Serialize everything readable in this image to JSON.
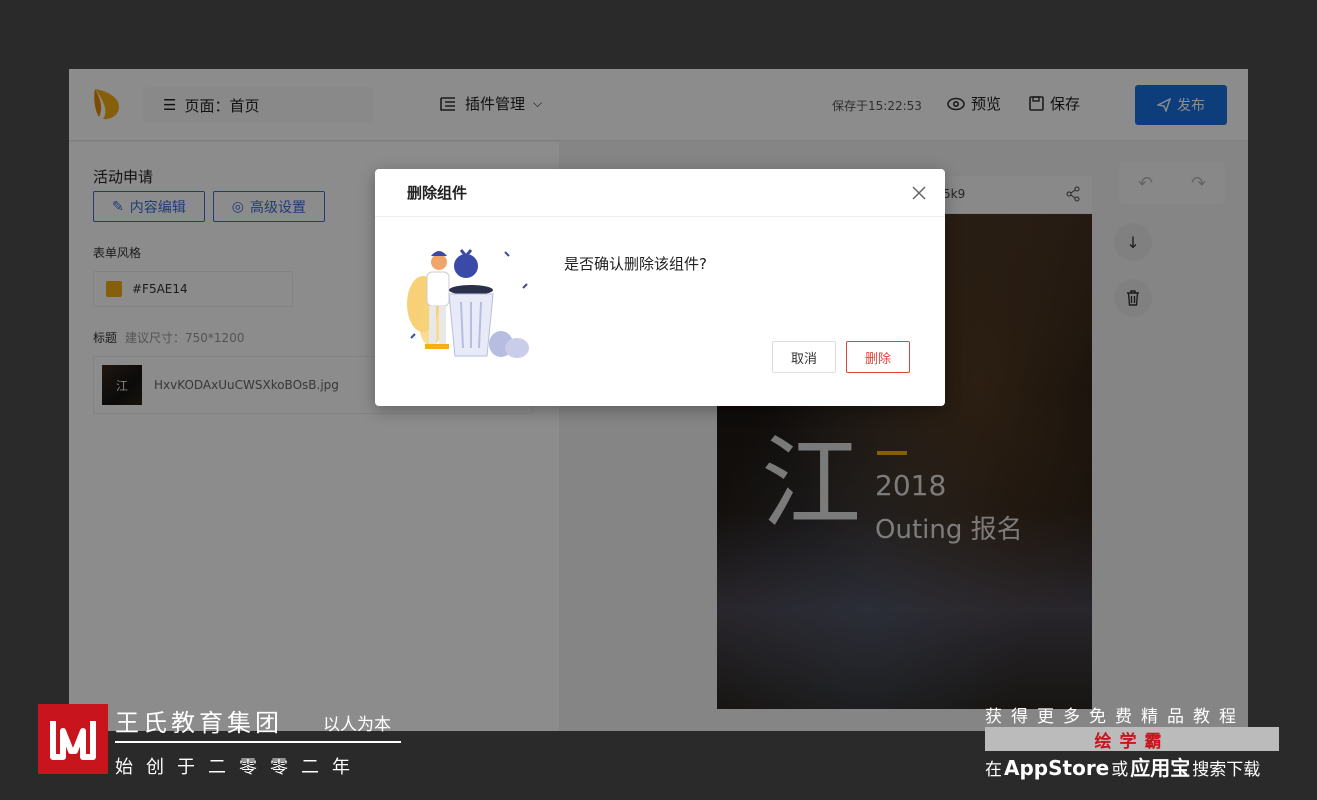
{
  "app": {
    "page_selector_label": "页面：首页",
    "plugin_manager_label": "插件管理",
    "saved_at": "保存于15:22:53",
    "preview_label": "预览",
    "save_label": "保存",
    "publish_label": "发布",
    "brand_color": "#1a6fe0"
  },
  "left_panel": {
    "section_title": "活动申请",
    "tabs": [
      {
        "label": "内容编辑",
        "icon": "edit-icon"
      },
      {
        "label": "高级设置",
        "icon": "settings-icon"
      }
    ],
    "form_style_label": "表单风格",
    "color_value": "#F5AE14",
    "title_label": "标题",
    "title_hint": "建议尺寸：750*1200",
    "file_name": "HxvKODAxUuCWSXkoBOsB.jpg",
    "thumb_char": "江"
  },
  "preview": {
    "url_fragment": "5k9",
    "poster_char": "江",
    "poster_year": "2018",
    "poster_sub": "Outing 报名",
    "help_label": "?"
  },
  "modal": {
    "title": "删除组件",
    "message": "是否确认删除该组件?",
    "cancel_label": "取消",
    "delete_label": "删除"
  },
  "watermark_left": {
    "title": "王氏教育集团",
    "tagline": "以人为本",
    "since": "始创于二零零二年"
  },
  "watermark_right": {
    "line1": "获得更多免费精品教程",
    "brand": "绘学霸",
    "line3_pre": "在",
    "line3_app": "AppStore",
    "line3_or": "或",
    "line3_store": "应用宝",
    "line3_post": "搜索下载"
  }
}
